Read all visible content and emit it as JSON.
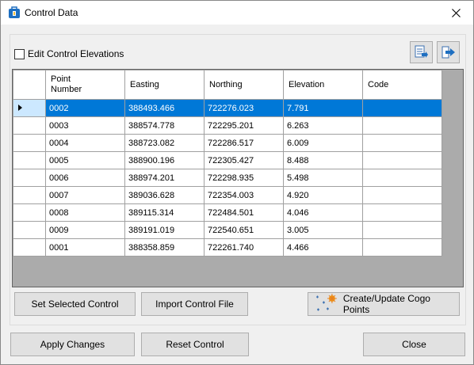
{
  "window": {
    "title": "Control Data",
    "close_glyph": "✕"
  },
  "options": {
    "edit_elevations_label": "Edit Control Elevations",
    "edit_elevations_checked": false
  },
  "toolbar": {
    "export_icon": "export-table-icon",
    "exit_icon": "exit-arrow-icon"
  },
  "table": {
    "columns": [
      "Point\nNumber",
      "Easting",
      "Northing",
      "Elevation",
      "Code"
    ],
    "rows": [
      [
        "0002",
        "388493.466",
        "722276.023",
        "7.791",
        ""
      ],
      [
        "0003",
        "388574.778",
        "722295.201",
        "6.263",
        ""
      ],
      [
        "0004",
        "388723.082",
        "722286.517",
        "6.009",
        ""
      ],
      [
        "0005",
        "388900.196",
        "722305.427",
        "8.488",
        ""
      ],
      [
        "0006",
        "388974.201",
        "722298.935",
        "5.498",
        ""
      ],
      [
        "0007",
        "389036.628",
        "722354.003",
        "4.920",
        ""
      ],
      [
        "0008",
        "389115.314",
        "722484.501",
        "4.046",
        ""
      ],
      [
        "0009",
        "389191.019",
        "722540.651",
        "3.005",
        ""
      ],
      [
        "0001",
        "388358.859",
        "722261.740",
        "4.466",
        ""
      ]
    ],
    "selected_row": 0
  },
  "actions": {
    "set_selected": "Set Selected Control",
    "import_file": "Import Control File",
    "create_update": "Create/Update Cogo Points"
  },
  "footer": {
    "apply": "Apply Changes",
    "reset": "Reset Control",
    "close": "Close"
  },
  "colors": {
    "selection": "#0078d7",
    "accent_border": "#0078d7"
  }
}
